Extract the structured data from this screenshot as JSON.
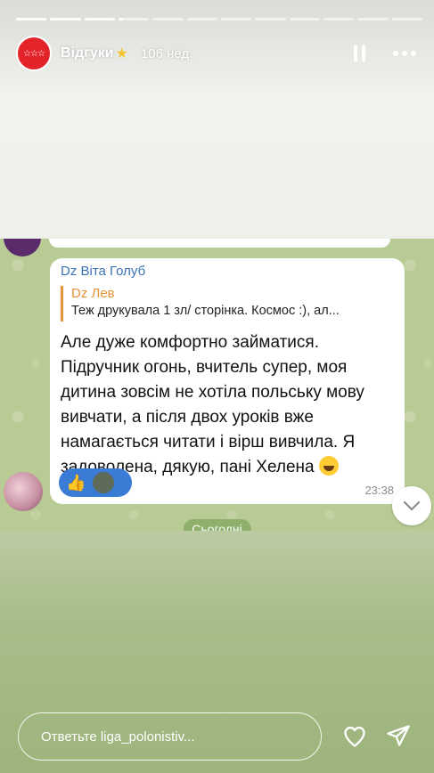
{
  "story": {
    "segments_total": 12,
    "segments_complete": 3,
    "current_segment_progress": 0.15
  },
  "header": {
    "avatar_text": "☆☆☆",
    "username": "Відгуки",
    "username_emoji": "★",
    "age": "106 нед.",
    "pause_icon": "pause-icon",
    "more_icon": "more-icon"
  },
  "chat": {
    "sender": "Dz Віта Голуб",
    "reply_name": "Dz Лев",
    "reply_text": "Теж друкувала 1 зл/ сторінка. Космос :), ал...",
    "message": "Але дуже комфортно займатися. Підручник огонь, вчитель супер, моя дитина зовсім не хотіла польську мову вивчати, а після двох уроків вже намагається читати і вірш вивчила. Я задоволена, дякую, пані Хелена",
    "reaction": "👍",
    "time": "23:38",
    "date_pill": "Сьогодні"
  },
  "footer": {
    "reply_placeholder": "Ответьте liga_polonistiv...",
    "heart_icon": "heart-icon",
    "send_icon": "send-icon"
  },
  "colors": {
    "brand_red": "#e2232a",
    "telegram_blue": "#3a72b5",
    "reply_orange": "#e8943a",
    "chat_bg": "#b9cb94"
  }
}
